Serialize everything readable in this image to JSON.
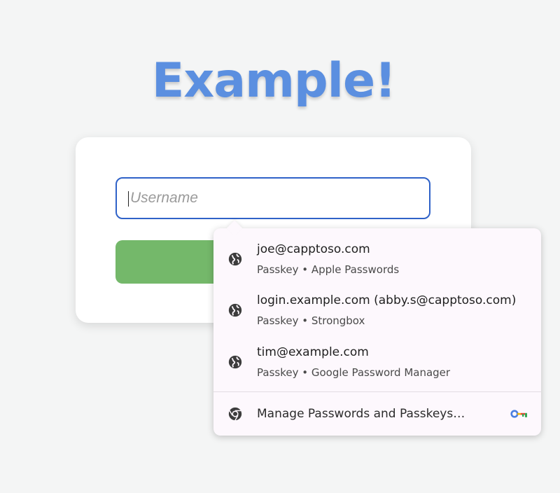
{
  "page": {
    "title": "Example!"
  },
  "form": {
    "username_placeholder": "Username"
  },
  "autofill": {
    "items": [
      {
        "title": "joe@capptoso.com",
        "subtitle": "Passkey • Apple Passwords",
        "icon": "globe-icon"
      },
      {
        "title": "login.example.com (abby.s@capptoso.com)",
        "subtitle": "Passkey • Strongbox",
        "icon": "globe-icon"
      },
      {
        "title": "tim@example.com",
        "subtitle": "Passkey • Google Password Manager",
        "icon": "globe-icon"
      }
    ],
    "manage_label": "Manage Passwords and Passkeys…",
    "manage_icon": "chrome-icon",
    "trailing_icon": "password-key-icon"
  },
  "colors": {
    "title": "#5b8fe0",
    "input_border": "#2f62c8",
    "submit_button": "#74b86a",
    "popup_background": "#fdf8fd"
  }
}
